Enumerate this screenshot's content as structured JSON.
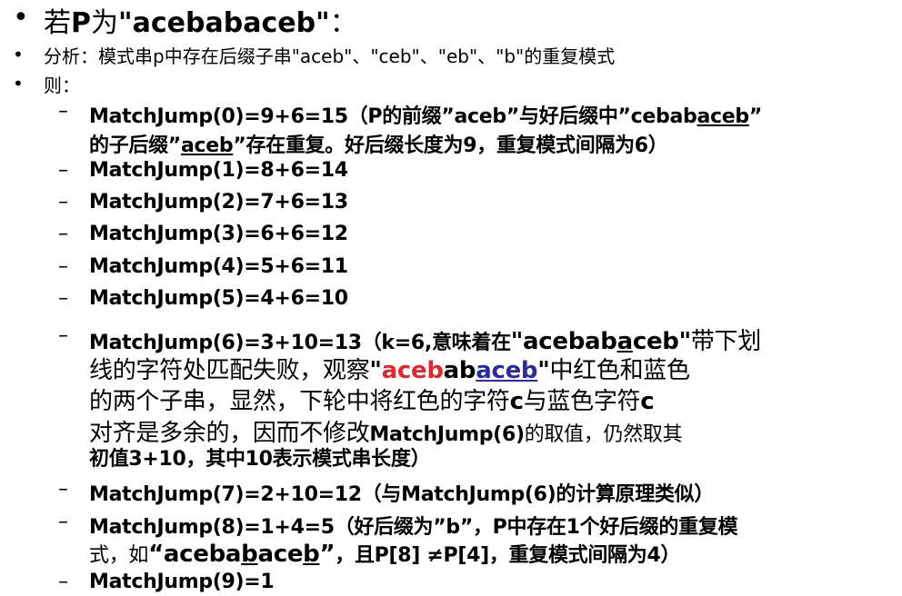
{
  "title": {
    "pre": "若",
    "p": "P",
    "mid": "为",
    "q": "\"acebabaceb\"",
    "post": "："
  },
  "analysis": "分析：模式串p中存在后缀子串\"aceb\"、\"ceb\"、\"eb\"、\"b\"的重复模式",
  "then": "则：",
  "items": [
    {
      "a": "MatchJump(0)=9+6=15（P的前缀”aceb”与好后缀中”cebab",
      "b": "aceb",
      "c": "”",
      "d": "的子后缀”",
      "e": "aceb",
      "f": "”存在重复。好后缀长度为9，重复模式间隔为6）"
    },
    "MatchJump(1)=8+6=14",
    "MatchJump(2)=7+6=13",
    "MatchJump(3)=6+6=12",
    "MatchJump(4)=5+6=11",
    "MatchJump(5)=4+6=10",
    {
      "a": "MatchJump(6)=3+10=13（k=6,意味着在",
      "b": "\"acebab",
      "c": "a",
      "d": "ceb\"",
      "e": "带下划",
      "f": "线的字符处匹配失败，观察",
      "g": "\"",
      "h": "aceb",
      "i": "ab",
      "j": "aceb",
      "k": "\"",
      "l": "中红色和蓝色",
      "m": "的两个子串，显然，下轮中将红色的字符",
      "n": "c",
      "o": "与蓝色字符",
      "p": "c",
      "q": "对齐是多余的，因而不修改",
      "r": "MatchJump(6)",
      "s": "的取值，仍然取其",
      "t": "初值3+10，其中10表示模式串长度）"
    },
    "MatchJump(7)=2+10=12（与MatchJump(6)的计算原理类似）",
    {
      "a": "MatchJump(8)=1+4=5（好后缀为”b”，P中存在1个好后缀的重复模",
      "b": "式，如",
      "c": "“aceba",
      "d": "b",
      "e": "ace",
      "f": "b",
      "g": "”",
      "h": "，且P[8] ≠P[4]，重复模式间隔为4）"
    },
    "MatchJump(9)=1"
  ],
  "bullet": "•",
  "dash": "–"
}
